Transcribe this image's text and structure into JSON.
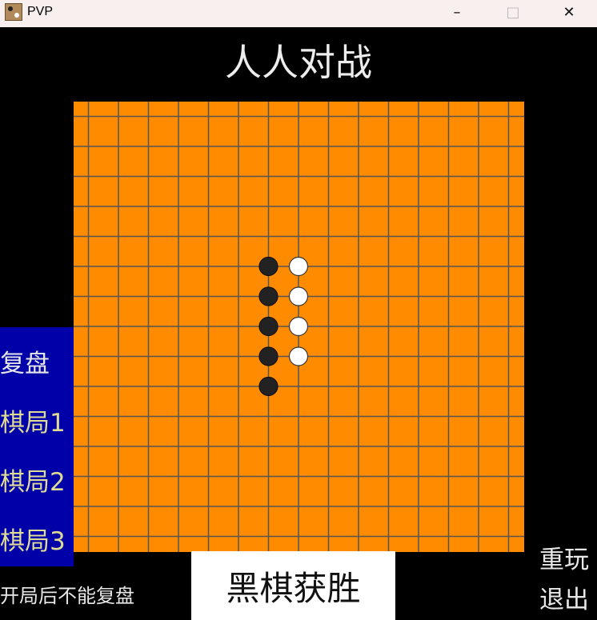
{
  "window": {
    "title": "PVP",
    "minimize_glyph": "–",
    "maximize_glyph": "□",
    "close_glyph": "✕"
  },
  "heading": "人人对战",
  "board": {
    "size": 15,
    "colors": {
      "background": "#ff8c00",
      "grid": "#555555",
      "black": "#222222",
      "white": "#ffffff"
    },
    "black_stones": [
      [
        6,
        5
      ],
      [
        6,
        6
      ],
      [
        6,
        7
      ],
      [
        6,
        8
      ],
      [
        6,
        9
      ]
    ],
    "white_stones": [
      [
        7,
        5
      ],
      [
        7,
        6
      ],
      [
        7,
        7
      ],
      [
        7,
        8
      ]
    ]
  },
  "sidebar": {
    "items": [
      {
        "label": "复盘"
      },
      {
        "label": "棋局1"
      },
      {
        "label": "棋局2"
      },
      {
        "label": "棋局3"
      }
    ]
  },
  "hint": "开局后不能复盘",
  "status": "黑棋获胜",
  "actions": {
    "replay": "重玩",
    "quit": "退出"
  }
}
